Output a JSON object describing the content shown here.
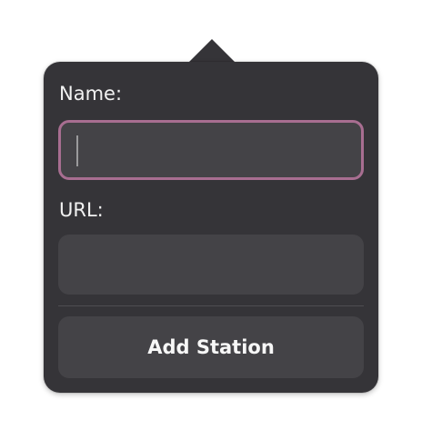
{
  "form": {
    "name_label": "Name:",
    "name_value": "",
    "url_label": "URL:",
    "url_value": "",
    "submit_label": "Add Station"
  },
  "colors": {
    "popover_bg": "#353438",
    "field_bg": "#444347",
    "focus_border": "#a86e91",
    "text": "#f2f2f2"
  }
}
